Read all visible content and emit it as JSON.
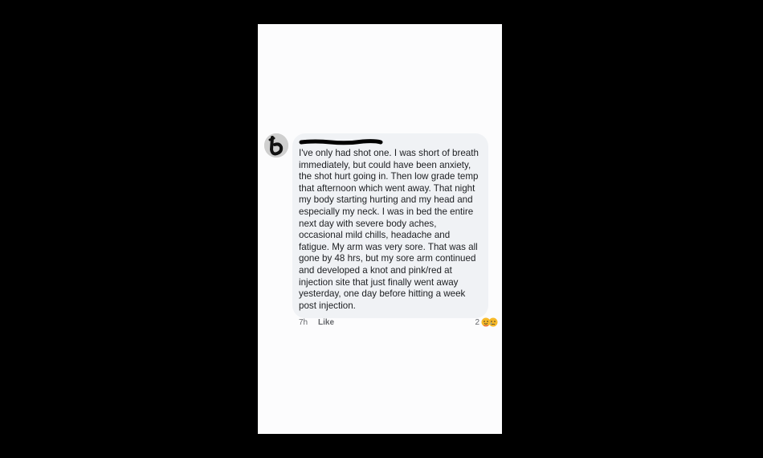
{
  "comment": {
    "author_redacted": true,
    "text": "I've only had shot one. I was short of breath immediately, but could have been anxiety, the shot hurt going in. Then low grade temp that afternoon which went away. That night my body starting hurting and my head and especially my neck. I was in bed the entire next day with severe body aches, occasional mild chills, headache and fatigue. My arm was very sore. That was all gone by 48 hrs, but my sore arm continued and developed a knot and pink/red at injection site that just finally went away yesterday, one day before hitting a week post injection.",
    "time": "7h",
    "like_label": "Like",
    "reaction_count": "2",
    "reaction_icons": [
      "care-emoji-icon",
      "sad-emoji-icon"
    ]
  },
  "colors": {
    "bubble_bg": "#f0f2f5",
    "text": "#1c1e21",
    "meta_text": "#65676b",
    "screen_bg": "#fcfcfd"
  }
}
